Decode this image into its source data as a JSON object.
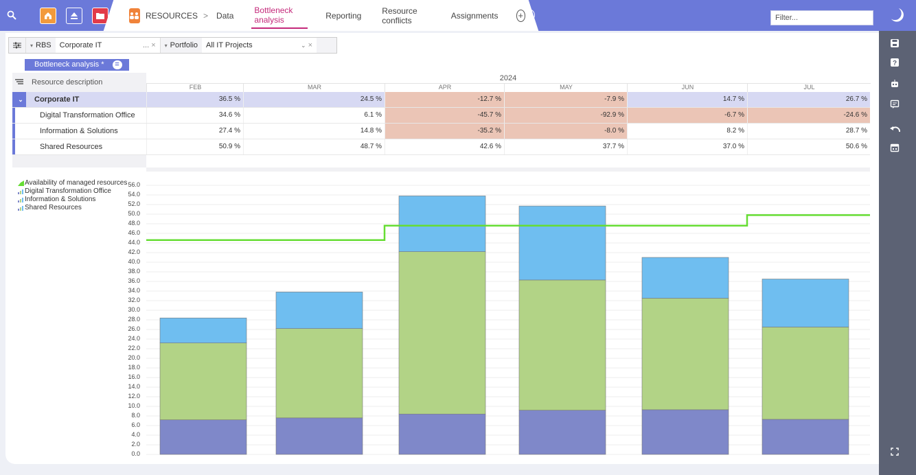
{
  "topbar": {
    "crumb_root": "RESOURCES",
    "crumb_sep": ">",
    "tabs": [
      "Data",
      "Bottleneck analysis",
      "Reporting",
      "Resource conflicts",
      "Assignments"
    ],
    "filter_placeholder": "Filter..."
  },
  "toolbar": {
    "rbs_label": "RBS",
    "rbs_value": "Corporate IT",
    "rbs_dots": "...",
    "clear": "×",
    "portfolio_label": "Portfolio",
    "portfolio_value": "All IT Projects"
  },
  "saved_tab": {
    "label": "Bottleneck analysis *",
    "eq": "="
  },
  "grid": {
    "desc_header": "Resource description",
    "year": "2024",
    "months": [
      "FEB",
      "MAR",
      "APR",
      "MAY",
      "JUN",
      "JUL"
    ],
    "rows": [
      {
        "name": "Corporate IT",
        "values": [
          "36.5 %",
          "24.5 %",
          "-12.7 %",
          "-7.9 %",
          "14.7 %",
          "26.7 %"
        ]
      },
      {
        "name": "Digital Transformation Office",
        "values": [
          "34.6 %",
          "6.1 %",
          "-45.7 %",
          "-92.9 %",
          "-6.7 %",
          "-24.6 %"
        ]
      },
      {
        "name": "Information & Solutions",
        "values": [
          "27.4 %",
          "14.8 %",
          "-35.2 %",
          "-8.0 %",
          "8.2 %",
          "28.7 %"
        ]
      },
      {
        "name": "Shared Resources",
        "values": [
          "50.9 %",
          "48.7 %",
          "42.6 %",
          "37.7 %",
          "37.0 %",
          "50.6 %"
        ]
      }
    ]
  },
  "legend": [
    "Availability of managed resources",
    "Digital Transformation Office",
    "Information & Solutions",
    "Shared Resources"
  ],
  "colors": {
    "accent": "#6b79d9",
    "active_tab": "#c4287a",
    "availability": "#66dd33",
    "digital": "#6fbef0",
    "info": "#b2d386",
    "shared": "#7f88c9",
    "negative_cell": "#ebc5b6",
    "highlight_row": "#d7d9f3"
  },
  "chart_data": {
    "type": "bar",
    "stacked": true,
    "categories": [
      "FEB",
      "MAR",
      "APR",
      "MAY",
      "JUN",
      "JUL"
    ],
    "ylim": [
      0,
      56
    ],
    "yticks": [
      "0.0",
      "2.0",
      "4.0",
      "6.0",
      "8.0",
      "10.0",
      "12.0",
      "14.0",
      "16.0",
      "18.0",
      "20.0",
      "22.0",
      "24.0",
      "26.0",
      "28.0",
      "30.0",
      "32.0",
      "34.0",
      "36.0",
      "38.0",
      "40.0",
      "42.0",
      "44.0",
      "46.0",
      "48.0",
      "50.0",
      "52.0",
      "54.0",
      "56.0"
    ],
    "series": [
      {
        "name": "Shared Resources",
        "values": [
          7.2,
          7.6,
          8.4,
          9.2,
          9.3,
          7.3
        ]
      },
      {
        "name": "Information & Solutions",
        "values": [
          16.0,
          18.6,
          33.8,
          27.1,
          23.2,
          19.2
        ]
      },
      {
        "name": "Digital Transformation Office",
        "values": [
          5.2,
          7.6,
          11.6,
          15.4,
          8.5,
          10.0
        ]
      }
    ],
    "line": {
      "name": "Availability of managed resources",
      "values": [
        44.6,
        47.6,
        47.6,
        47.6,
        47.6,
        49.8
      ]
    }
  }
}
